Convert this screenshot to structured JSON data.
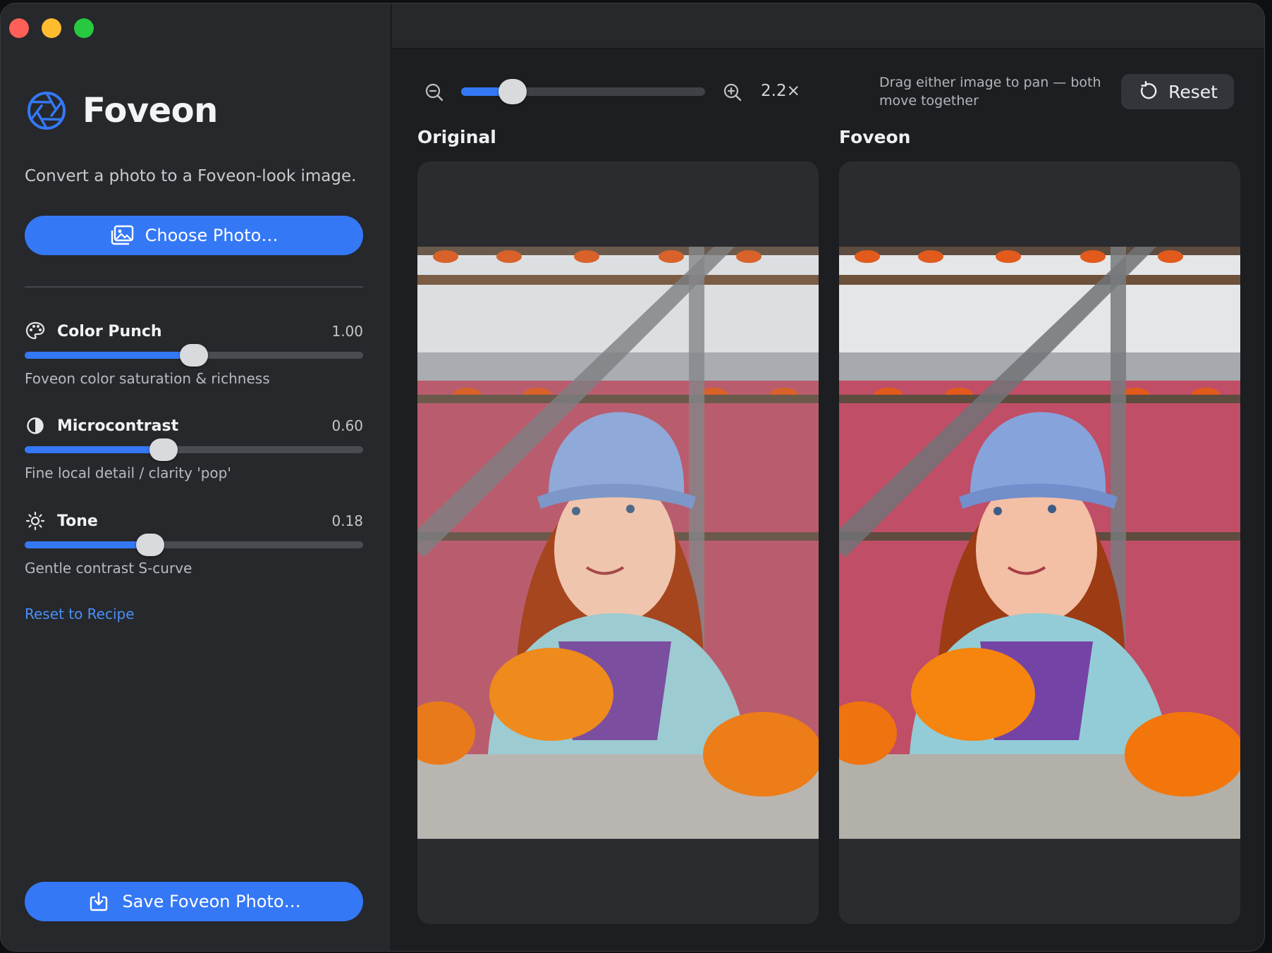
{
  "app": {
    "name": "Foveon",
    "tagline": "Convert a photo to a Foveon-look image."
  },
  "colors": {
    "accent": "#3478f6",
    "link": "#4b8ff7",
    "sidebar_bg": "#26282c",
    "main_bg": "#1d1e21"
  },
  "sidebar": {
    "choose_button": {
      "label": "Choose Photo…",
      "icon": "photo-stack-icon"
    },
    "controls": [
      {
        "name": "Color Punch",
        "value": "1.00",
        "level": 0.5,
        "description": "Foveon color saturation & richness",
        "icon": "palette-icon"
      },
      {
        "name": "Microcontrast",
        "value": "0.60",
        "level": 0.41,
        "description": "Fine local detail / clarity 'pop'",
        "icon": "half-circle-icon"
      },
      {
        "name": "Tone",
        "value": "0.18",
        "level": 0.37,
        "description": "Gentle contrast S-curve",
        "icon": "sun-icon"
      }
    ],
    "reset_link": "Reset to Recipe",
    "save_button": {
      "label": "Save Foveon Photo…",
      "icon": "save-export-icon"
    }
  },
  "toolbar": {
    "zoom_label": "2.2×",
    "zoom_level": 0.21,
    "pan_hint": "Drag either image to pan — both move together",
    "reset_label": "Reset"
  },
  "panes": [
    {
      "title": "Original"
    },
    {
      "title": "Foveon"
    }
  ]
}
